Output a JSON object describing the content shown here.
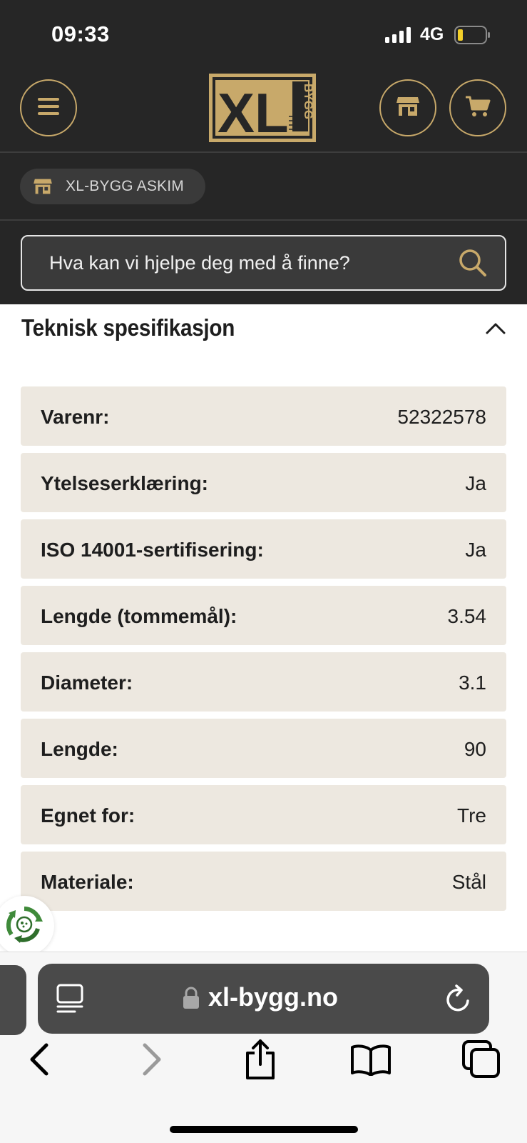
{
  "status_bar": {
    "time": "09:33",
    "network": "4G",
    "icons": [
      "signal-icon",
      "battery-icon"
    ]
  },
  "header": {
    "logo_text": "XL",
    "logo_subtext": "BYGG",
    "icons": [
      "menu-icon",
      "store-icon",
      "cart-icon"
    ],
    "accent_color": "#c8a96a",
    "background_color": "#262626"
  },
  "store": {
    "name": "XL-BYGG ASKIM",
    "icon": "store-icon"
  },
  "search": {
    "placeholder": "Hva kan vi hjelpe deg med å finne?",
    "icon": "search-icon"
  },
  "spec_section": {
    "title": "Teknisk spesifikasjon",
    "expanded": true,
    "row_background": "#ede8e0",
    "rows": [
      {
        "label": "Varenr:",
        "value": "52322578"
      },
      {
        "label": "Ytelseserklæring:",
        "value": "Ja"
      },
      {
        "label": "ISO 14001-sertifisering:",
        "value": "Ja"
      },
      {
        "label": "Lengde (tommemål):",
        "value": "3.54"
      },
      {
        "label": "Diameter:",
        "value": "3.1"
      },
      {
        "label": "Lengde:",
        "value": "90"
      },
      {
        "label": "Egnet for:",
        "value": "Tre"
      },
      {
        "label": "Materiale:",
        "value": "Stål"
      }
    ]
  },
  "browser": {
    "url": "xl-bygg.no",
    "icons": [
      "tabs-icon",
      "lock-icon",
      "reload-icon",
      "back-icon",
      "forward-icon",
      "share-icon",
      "bookmarks-icon",
      "tab-overview-icon"
    ]
  }
}
